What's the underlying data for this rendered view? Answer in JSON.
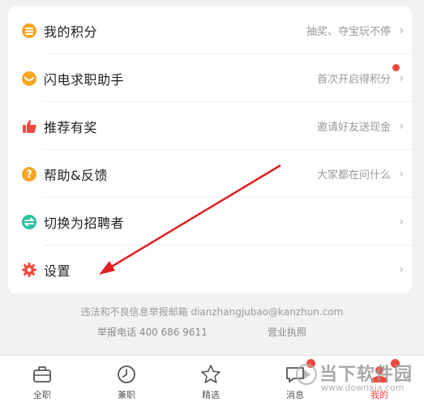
{
  "menu": [
    {
      "label": "我的积分",
      "hint": "抽奖、夺宝玩不停",
      "icon": "coin-icon"
    },
    {
      "label": "闪电求职助手",
      "hint": "首次开启得积分",
      "icon": "assistant-icon",
      "badge": true
    },
    {
      "label": "推荐有奖",
      "hint": "邀请好友送现金",
      "icon": "thumbs-up-icon"
    },
    {
      "label": "帮助&反馈",
      "hint": "大家都在问什么",
      "icon": "help-icon"
    },
    {
      "label": "切换为招聘者",
      "hint": "",
      "icon": "switch-icon"
    },
    {
      "label": "设置",
      "hint": "",
      "icon": "gear-icon"
    }
  ],
  "footer": {
    "report_email_line": "违法和不良信息举报邮箱  dianzhangjubao@kanzhun.com",
    "report_phone": "举报电话  400 686 9611",
    "license": "营业执照"
  },
  "tabs": [
    {
      "label": "全职",
      "icon": "briefcase-icon"
    },
    {
      "label": "兼职",
      "icon": "clock-icon"
    },
    {
      "label": "精选",
      "icon": "star-icon"
    },
    {
      "label": "消息",
      "icon": "message-icon"
    },
    {
      "label": "我的",
      "icon": "profile-icon",
      "active": true
    }
  ],
  "watermark": {
    "text": "当下软件园",
    "url": "www.downxia.com"
  },
  "colors": {
    "accent": "#f04a3e",
    "orange": "#f5a623",
    "arrow": "#e02020"
  }
}
